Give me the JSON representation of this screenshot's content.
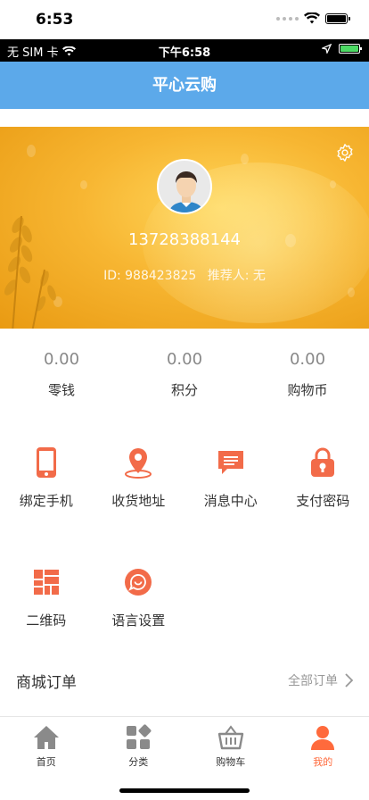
{
  "os_status": {
    "time": "6:53"
  },
  "app_status": {
    "carrier": "无 SIM 卡",
    "time": "下午6:58"
  },
  "nav": {
    "title": "平心云购"
  },
  "profile": {
    "phone": "13728388144",
    "id_text": "ID: 988423825",
    "referrer_text": "推荐人: 无"
  },
  "stats": [
    {
      "value": "0.00",
      "label": "零钱"
    },
    {
      "value": "0.00",
      "label": "积分"
    },
    {
      "value": "0.00",
      "label": "购物币"
    }
  ],
  "menu": [
    {
      "label": "绑定手机",
      "icon": "phone-icon"
    },
    {
      "label": "收货地址",
      "icon": "location-pin-icon"
    },
    {
      "label": "消息中心",
      "icon": "message-icon"
    },
    {
      "label": "支付密码",
      "icon": "lock-icon"
    },
    {
      "label": "二维码",
      "icon": "qr-code-icon"
    },
    {
      "label": "语言设置",
      "icon": "language-icon"
    }
  ],
  "orders": {
    "title": "商城订单",
    "all_label": "全部订单"
  },
  "tabs": [
    {
      "label": "首页",
      "icon": "home-icon"
    },
    {
      "label": "分类",
      "icon": "category-icon"
    },
    {
      "label": "购物车",
      "icon": "cart-icon"
    },
    {
      "label": "我的",
      "icon": "user-icon",
      "active": true
    }
  ],
  "colors": {
    "nav_blue": "#5ca9ea",
    "accent_orange": "#ff6a3c",
    "hero_gold": "#f7b632"
  }
}
